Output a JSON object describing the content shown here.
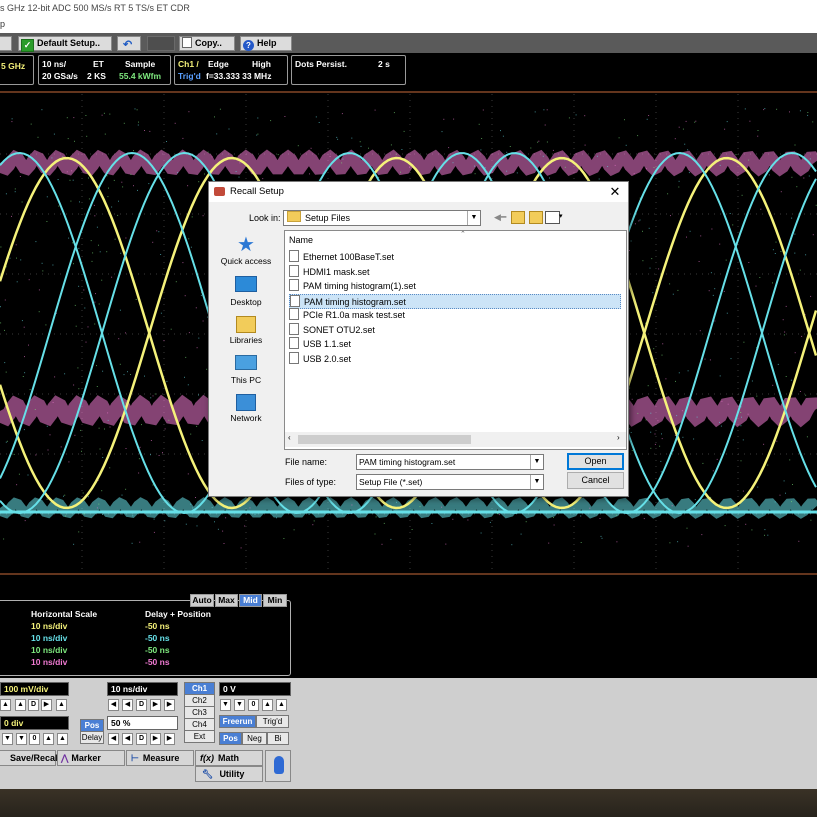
{
  "titlebar": {
    "text": "s GHz  12-bit ADC  500 MS/s RT  5 TS/s ET    CDR"
  },
  "menubar": {
    "text": "p"
  },
  "toolbar": {
    "default_setup": "Default Setup..",
    "copy": "Copy..",
    "help": "Help"
  },
  "status": {
    "bw": "5 GHz",
    "timebase_top": "10 ns/",
    "timebase_mode": "ET",
    "acq_mode": "Sample",
    "sample_rate": "20 GSa/s",
    "record_len": "2 KS",
    "wfm_rate": "55.4 kWfm",
    "trig_src": "Ch1  /",
    "trig_type": "Edge",
    "trig_level": "High",
    "trig_state": "Trig'd",
    "trig_freq": "f=33.333 33 MHz",
    "persist_label": "Dots Persist.",
    "persist_val": "2 s"
  },
  "info": {
    "buttons": [
      "Auto",
      "Max",
      "Mid",
      "Min"
    ],
    "active_button": "Mid",
    "col1_header": "Horizontal Scale",
    "col2_header": "Delay + Position",
    "rows": [
      {
        "scale": "10 ns/div",
        "delay": "-50 ns",
        "color": "#f5f27a"
      },
      {
        "scale": "10 ns/div",
        "delay": "-50 ns",
        "color": "#66e0e8"
      },
      {
        "scale": "10 ns/div",
        "delay": "-50 ns",
        "color": "#7ee87e"
      },
      {
        "scale": "10 ns/div",
        "delay": "-50 ns",
        "color": "#f07ad2"
      }
    ]
  },
  "controls": {
    "vscale": "100 mV/div",
    "voffset": "0 div",
    "hscale": "10 ns/div",
    "hpos": "50 %",
    "pos_label": "Pos",
    "delay_label": "Delay",
    "ch_buttons": [
      "Ch1",
      "Ch2",
      "Ch3",
      "Ch4",
      "Ext"
    ],
    "trig_level": "0 V",
    "freerun": "Freerun",
    "trigd": "Trig'd",
    "slope": [
      "Pos",
      "Neg",
      "Bi"
    ],
    "d_label": "D",
    "zero_label": "0",
    "save_recall": "Save/Recall",
    "marker": "Marker",
    "measure": "Measure",
    "math": "Math",
    "utility": "Utility"
  },
  "dialog": {
    "title": "Recall Setup",
    "lookin_label": "Look in:",
    "lookin_value": "Setup Files",
    "places": [
      "Quick access",
      "Desktop",
      "Libraries",
      "This PC",
      "Network"
    ],
    "column_name": "Name",
    "files": [
      "Ethernet 100BaseT.set",
      "HDMI1 mask.set",
      "PAM timing histogram(1).set",
      "PAM timing histogram.set",
      "PCIe R1.0a mask test.set",
      "SONET OTU2.set",
      "USB 1.1.set",
      "USB 2.0.set"
    ],
    "selected_file": "PAM timing histogram.set",
    "filename_label": "File name:",
    "filename_value": "PAM timing histogram.set",
    "filetype_label": "Files of type:",
    "filetype_value": "Setup File (*.set)",
    "open_label": "Open",
    "cancel_label": "Cancel"
  },
  "colors": {
    "ch1": "#f5f27a",
    "ch2": "#66e0e8",
    "ch3": "#7ee87e",
    "ch4": "#f07ad2",
    "grid_frame": "#c76a3a"
  }
}
